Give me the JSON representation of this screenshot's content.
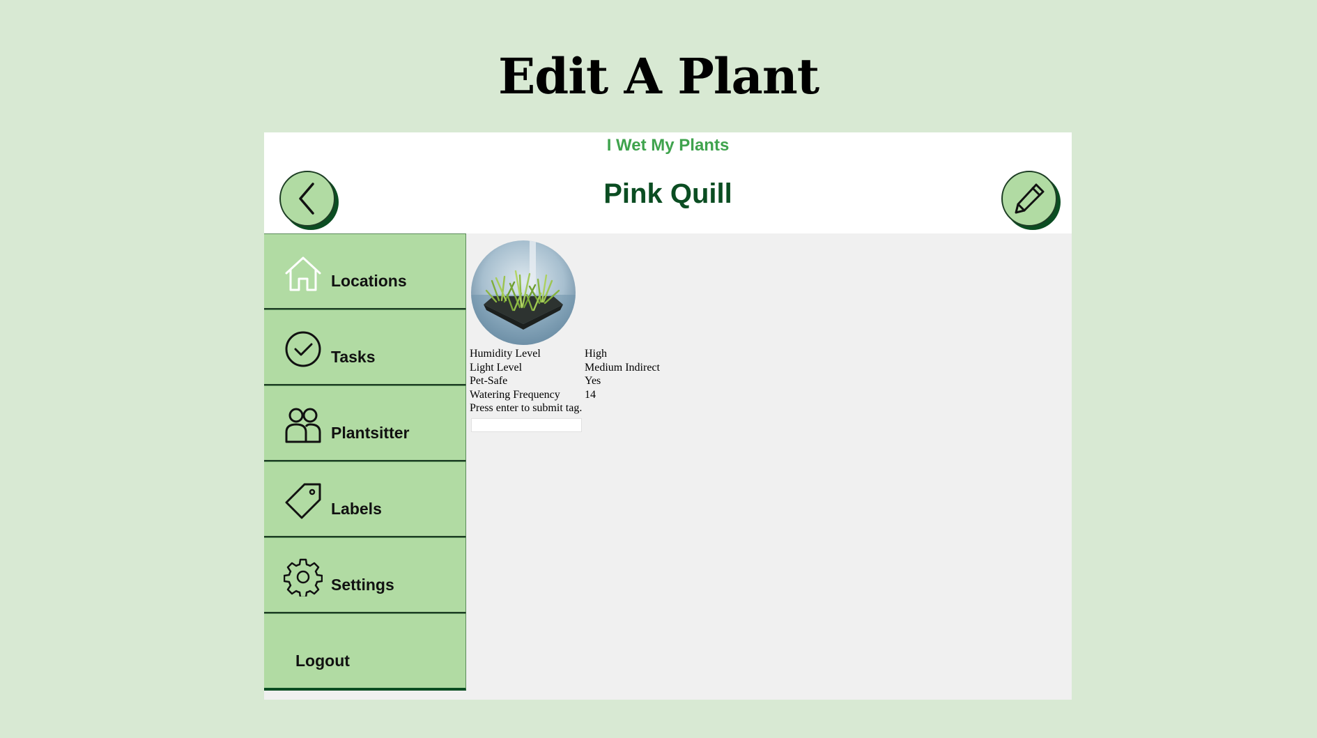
{
  "slide_title": "Edit A Plant",
  "app": {
    "brand": "I Wet My Plants",
    "page_title": "Pink Quill"
  },
  "sidebar": {
    "items": [
      {
        "label": "Locations",
        "icon": "home-icon"
      },
      {
        "label": "Tasks",
        "icon": "check-circle-icon"
      },
      {
        "label": "Plantsitter",
        "icon": "users-icon"
      },
      {
        "label": "Labels",
        "icon": "tag-icon"
      },
      {
        "label": "Settings",
        "icon": "gear-icon"
      },
      {
        "label": "Logout",
        "icon": ""
      }
    ]
  },
  "plant": {
    "details": [
      {
        "key": "Humidity Level",
        "value": "High"
      },
      {
        "key": "Light Level",
        "value": "Medium Indirect"
      },
      {
        "key": "Pet-Safe",
        "value": "Yes"
      },
      {
        "key": "Watering Frequency",
        "value": "14"
      }
    ],
    "tag_prompt": "Press enter to submit tag.",
    "tag_input_value": ""
  },
  "colors": {
    "background": "#d8e9d3",
    "nav_green": "#b1dba3",
    "dark_green": "#0b4d22",
    "brand_green": "#3fa34d"
  }
}
